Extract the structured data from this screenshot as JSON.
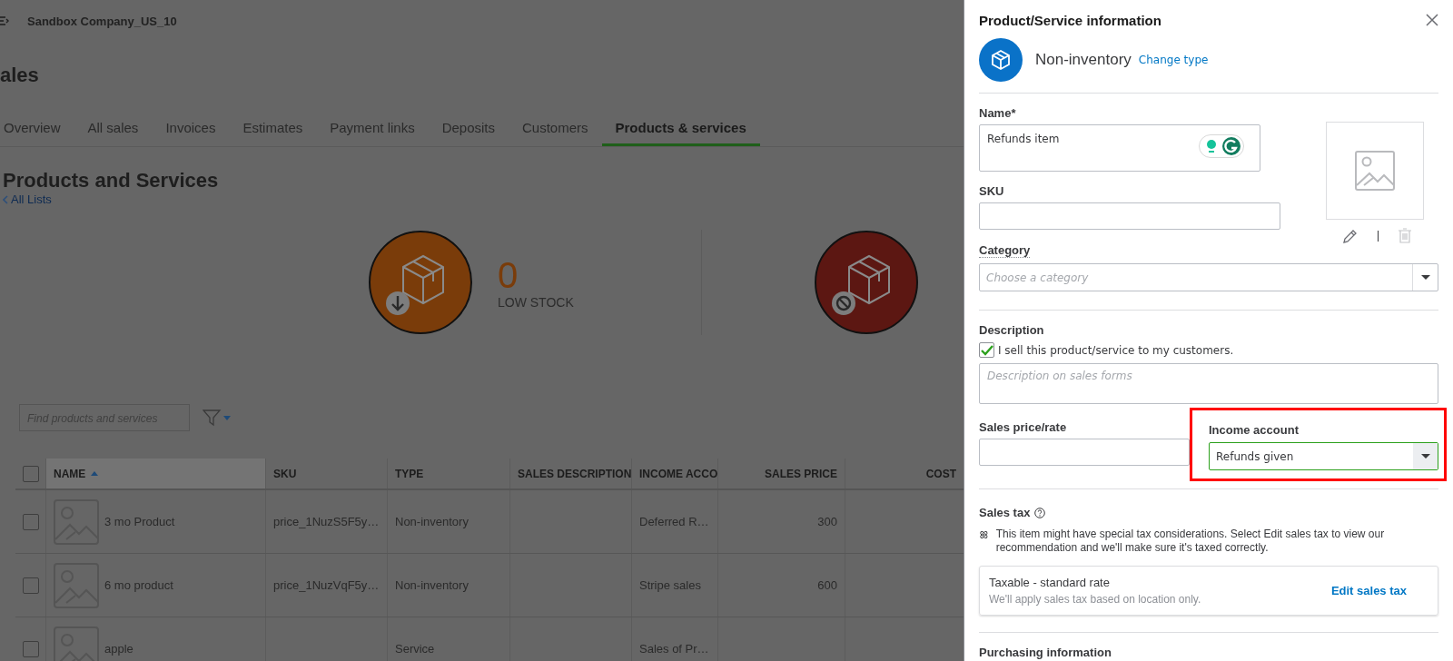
{
  "company": {
    "name": "Sandbox Company_US_10"
  },
  "page_title": "ales",
  "tabs": [
    {
      "label": "Overview",
      "selected": false
    },
    {
      "label": "All sales",
      "selected": false
    },
    {
      "label": "Invoices",
      "selected": false
    },
    {
      "label": "Estimates",
      "selected": false
    },
    {
      "label": "Payment links",
      "selected": false
    },
    {
      "label": "Deposits",
      "selected": false
    },
    {
      "label": "Customers",
      "selected": false
    },
    {
      "label": "Products & services",
      "selected": true
    }
  ],
  "heading": "Products and Services",
  "back_link": "All Lists",
  "stock_stats": [
    {
      "kind": "low_stock",
      "color": "#7a3c0a",
      "count": "0",
      "label": "LOW STOCK"
    },
    {
      "kind": "out_of_stock",
      "color": "#5c1712"
    }
  ],
  "search": {
    "placeholder": "Find products and services"
  },
  "table": {
    "select_all_checked": false,
    "columns": [
      {
        "label": "NAME",
        "sorted": true
      },
      {
        "label": "SKU",
        "sorted": false
      },
      {
        "label": "TYPE",
        "sorted": false
      },
      {
        "label": "SALES DESCRIPTION",
        "sorted": false
      },
      {
        "label": "INCOME ACCO",
        "sorted": false
      },
      {
        "label": "SALES PRICE",
        "sorted": false
      },
      {
        "label": "COST",
        "sorted": false
      }
    ],
    "rows": [
      {
        "checked": false,
        "cells": [
          "3 mo Product",
          "price_1NuzS5F5y…",
          "Non-inventory",
          "",
          "Deferred R…",
          "300",
          ""
        ]
      },
      {
        "checked": false,
        "cells": [
          "6 mo product",
          "price_1NuzVqF5y…",
          "Non-inventory",
          "",
          "Stripe sales",
          "600",
          ""
        ]
      },
      {
        "checked": false,
        "cells": [
          "apple",
          "",
          "Service",
          "",
          "Sales of Pr…",
          "",
          ""
        ]
      }
    ]
  },
  "panel": {
    "title": "Product/Service information",
    "type": "Non-inventory",
    "change_type": "Change type",
    "name": {
      "label": "Name*",
      "value": "Refunds item"
    },
    "sku": {
      "label": "SKU"
    },
    "category": {
      "label": "Category",
      "placeholder": "Choose a category"
    },
    "description": {
      "label": "Description",
      "sell_checkbox": {
        "label": "I sell this product/service to my customers.",
        "checked": true
      },
      "placeholder": "Description on sales forms"
    },
    "sales_price": {
      "label": "Sales price/rate"
    },
    "income_account": {
      "label": "Income account",
      "value": "Refunds given",
      "highlighted": true
    },
    "sales_tax": {
      "label": "Sales tax",
      "note": "This item might have special tax considerations. Select Edit sales tax to view our recommendation and we'll make sure it's taxed correctly.",
      "rate_title": "Taxable - standard rate",
      "rate_note": "We'll apply sales tax based on location only.",
      "edit": "Edit sales tax"
    },
    "purchasing": {
      "label": "Purchasing information"
    }
  }
}
